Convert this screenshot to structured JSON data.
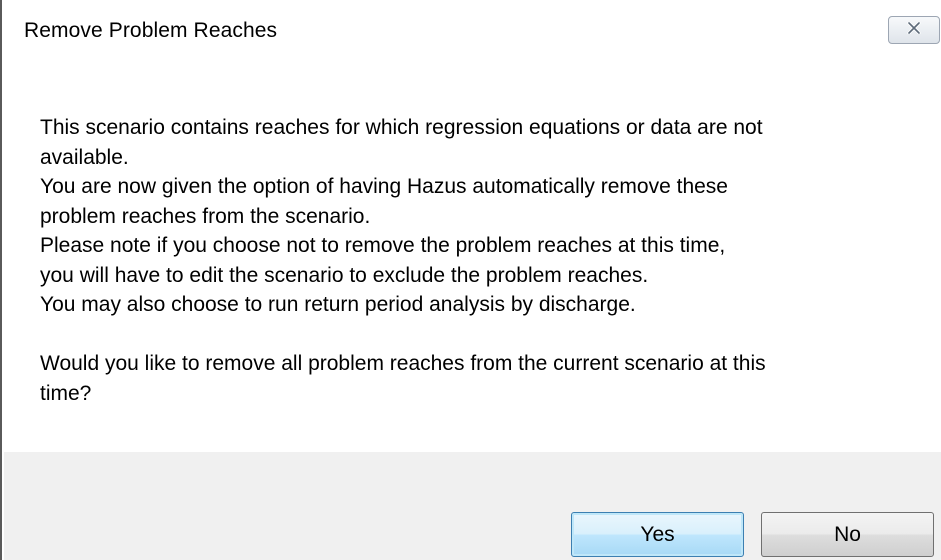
{
  "dialog": {
    "title": "Remove Problem Reaches",
    "close_icon": "close-icon",
    "message": {
      "line1": "This scenario contains reaches for which regression equations or data are not",
      "line2": "available.",
      "line3": "You are now given the option of having Hazus automatically remove these",
      "line4": "problem reaches from the scenario.",
      "line5": "Please note if you choose not to remove the problem reaches at this time,",
      "line6": "you will have to edit the scenario to exclude the problem reaches.",
      "line7": "You may also choose to run return period analysis by discharge.",
      "line8": "Would you like to remove all problem reaches from the current scenario at this",
      "line9": "time?"
    },
    "buttons": {
      "yes": "Yes",
      "no": "No"
    }
  }
}
